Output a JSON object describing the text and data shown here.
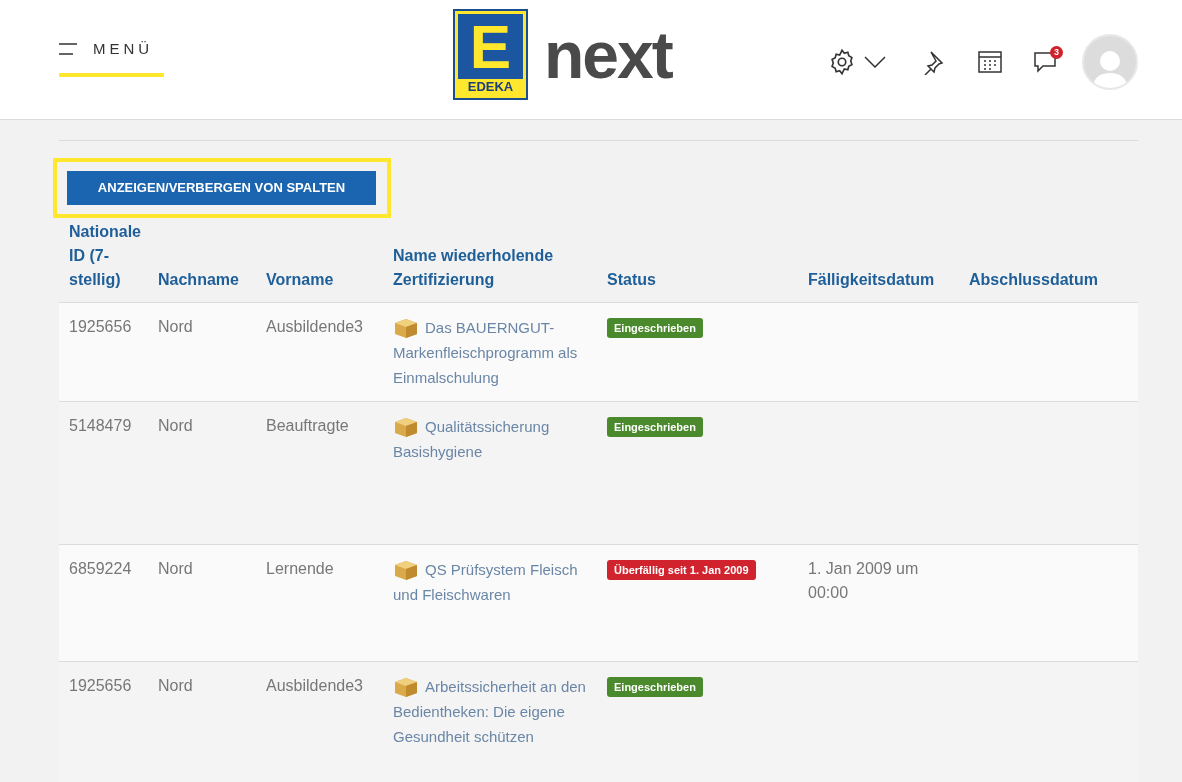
{
  "header": {
    "menu_label": "MENÜ",
    "logo": {
      "letter": "E",
      "brand": "EDEKA",
      "product": "next"
    },
    "notifications_count": "3"
  },
  "toolbar": {
    "button": "ANZEIGEN/VERBERGEN VON SPALTEN",
    "highlighted": true
  },
  "table": {
    "columns": [
      "Nationale ID (7-stellig)",
      "Nachname",
      "Vorname",
      "Name wiederholende Zertifizierung",
      "Status",
      "Fälligkeitsdatum",
      "Abschlussdatum"
    ],
    "rows": [
      {
        "id": "1925656",
        "last_name": "Nord",
        "first_name": "Ausbildende3",
        "certification": "Das BAUERNGUT-Markenfleischprogramm als Einmalschulung",
        "status": {
          "kind": "enrolled",
          "label": "Eingeschrieben"
        },
        "due": ""
      },
      {
        "id": "5148479",
        "last_name": "Nord",
        "first_name": "Beauftragte",
        "certification": "Qualitätssicherung Basishygiene",
        "status": {
          "kind": "enrolled",
          "label": "Eingeschrieben"
        },
        "due": ""
      },
      {
        "id": "6859224",
        "last_name": "Nord",
        "first_name": "Lernende",
        "certification": "QS Prüfsystem Fleisch und Fleischwaren",
        "status": {
          "kind": "overdue",
          "label": "Überfällig seit 1. Jan 2009"
        },
        "due": "1. Jan 2009 um 00:00"
      },
      {
        "id": "1925656",
        "last_name": "Nord",
        "first_name": "Ausbildende3",
        "certification": "Arbeitssicherheit an den Bedientheken: Die eigene Gesundheit schützen",
        "status": {
          "kind": "enrolled",
          "label": "Eingeschrieben"
        },
        "due": ""
      }
    ]
  }
}
